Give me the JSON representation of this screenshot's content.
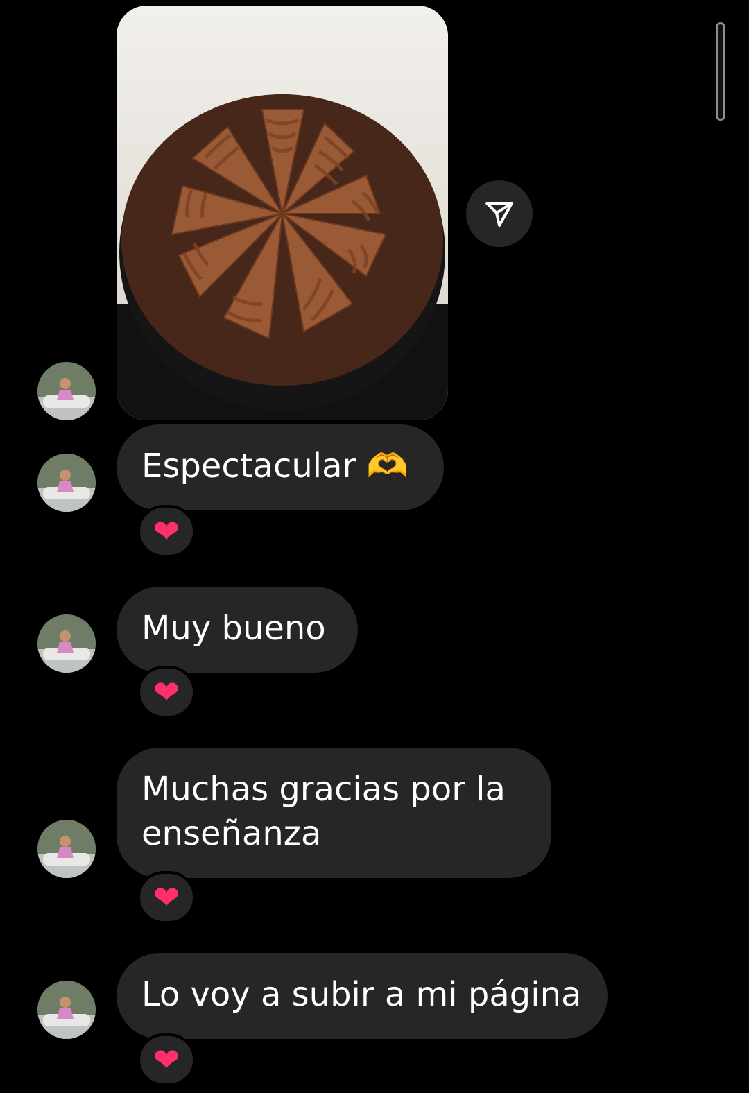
{
  "thread": {
    "messages": [
      {
        "id": "m1",
        "text": "Espectacular",
        "emoji": "🫶",
        "reaction": "❤"
      },
      {
        "id": "m2",
        "text": "Muy bueno",
        "reaction": "❤"
      },
      {
        "id": "m3",
        "text": "Muchas gracias por la enseñanza",
        "reaction": "❤"
      },
      {
        "id": "m4",
        "text": "Lo voy a subir a mi página",
        "reaction": "❤"
      }
    ]
  },
  "icons": {
    "share": "paper-plane-icon",
    "reaction": "heart-icon"
  },
  "colors": {
    "background": "#000000",
    "bubble": "#262626",
    "text": "#ffffff",
    "heart": "#ff2f6d"
  }
}
